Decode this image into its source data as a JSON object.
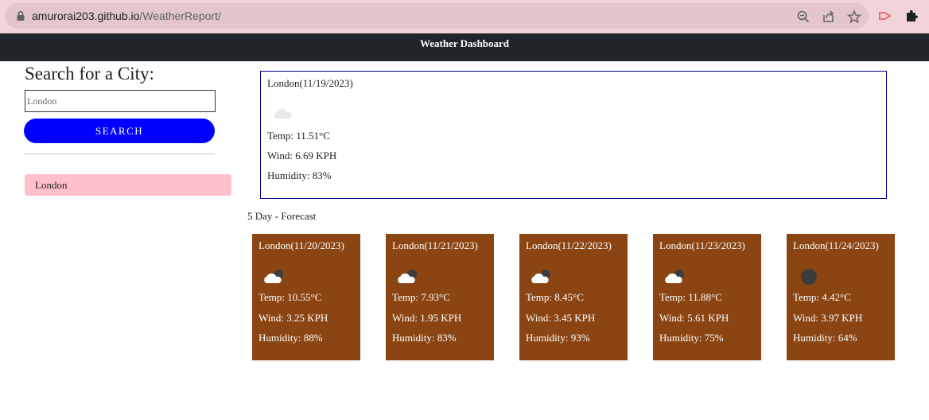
{
  "browser": {
    "url_host": "amurorai203.github.io",
    "url_path": "/WeatherReport/"
  },
  "navbar": {
    "title": "Weather Dashboard"
  },
  "search": {
    "heading": "Search for a City:",
    "placeholder": "London",
    "button_label": "SEARCH",
    "history": [
      "London"
    ]
  },
  "current": {
    "title": "London(11/19/2023)",
    "icon": "cloud-icon",
    "temp": "Temp: 11.51°C",
    "wind": "Wind: 6.69 KPH",
    "humidity": "Humidity: 83%"
  },
  "forecast_heading": "5 Day - Forecast",
  "forecast": [
    {
      "title": "London(11/20/2023)",
      "icon": "cloud-night-icon",
      "temp": "Temp: 10.55°C",
      "wind": "Wind: 3.25 KPH",
      "humidity": "Humidity: 88%"
    },
    {
      "title": "London(11/21/2023)",
      "icon": "cloud-night-icon",
      "temp": "Temp: 7.93°C",
      "wind": "Wind: 1.95 KPH",
      "humidity": "Humidity: 83%"
    },
    {
      "title": "London(11/22/2023)",
      "icon": "cloud-night-icon",
      "temp": "Temp: 8.45°C",
      "wind": "Wind: 3.45 KPH",
      "humidity": "Humidity: 93%"
    },
    {
      "title": "London(11/23/2023)",
      "icon": "cloud-night-icon",
      "temp": "Temp: 11.88°C",
      "wind": "Wind: 5.61 KPH",
      "humidity": "Humidity: 75%"
    },
    {
      "title": "London(11/24/2023)",
      "icon": "moon-icon",
      "temp": "Temp: 4.42°C",
      "wind": "Wind: 3.97 KPH",
      "humidity": "Humidity: 64%"
    }
  ],
  "colors": {
    "navbar": "#212529",
    "search_button": "#0000ff",
    "history_item": "#ffc0cb",
    "current_border": "#00008b",
    "forecast_card": "#8b4513"
  }
}
